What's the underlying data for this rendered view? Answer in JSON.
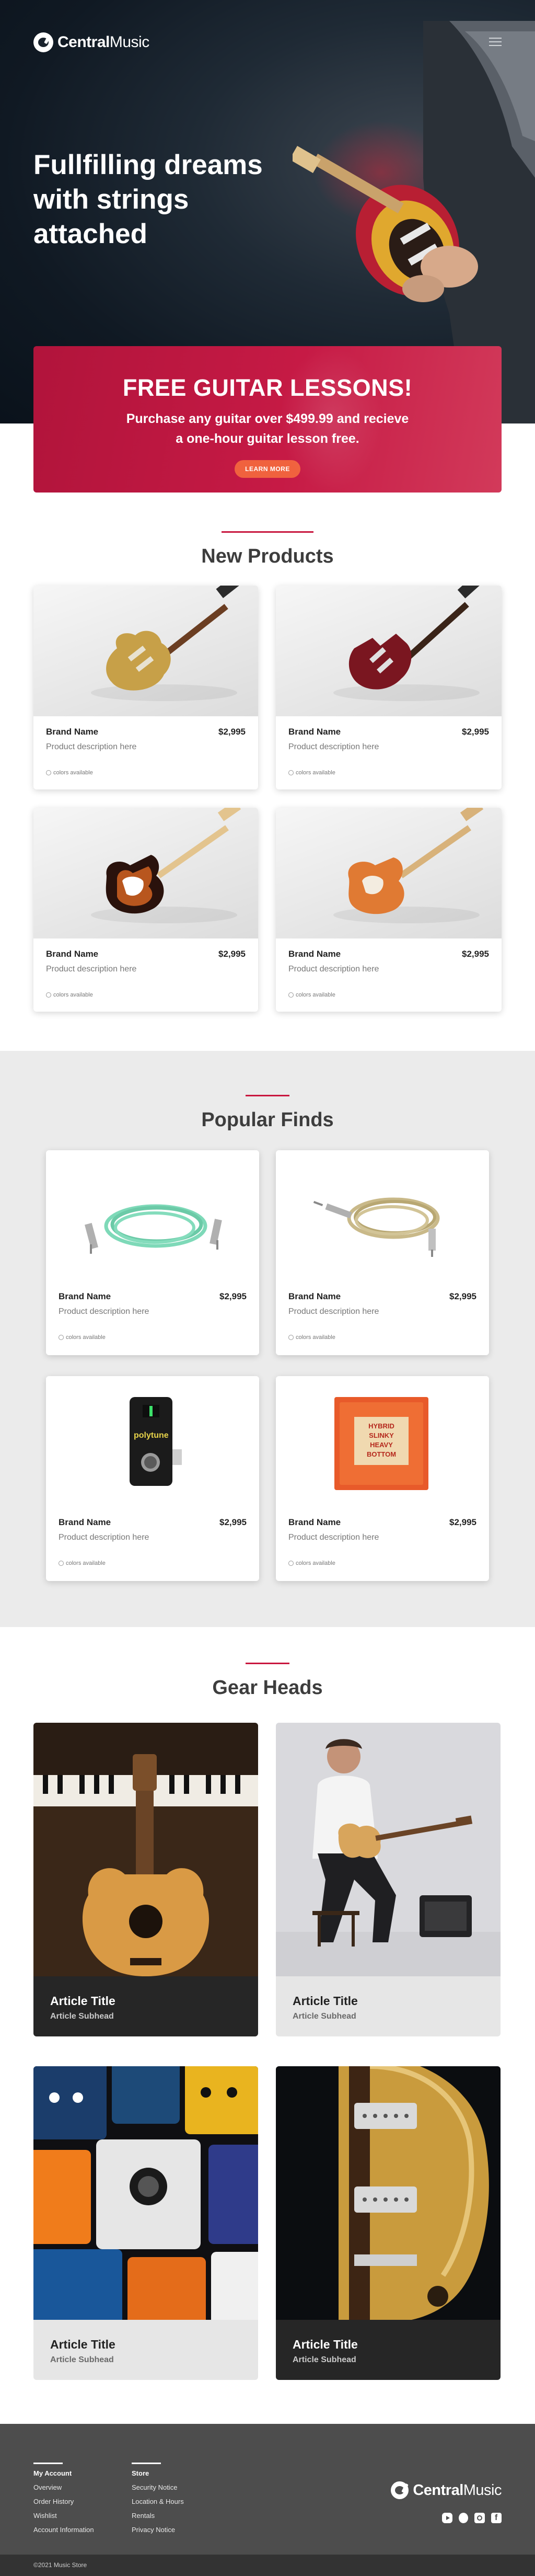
{
  "header": {
    "logo_bold": "Central",
    "logo_regular": "Music",
    "menu_icon": "hamburger-menu-icon"
  },
  "hero": {
    "title": "Fullfilling dreams with strings attached"
  },
  "promo": {
    "title": "FREE GUITAR LESSONS!",
    "text": "Purchase any guitar over $499.99 and recieve a one-hour guitar lesson free.",
    "button": "LEARN MORE",
    "colors": {
      "background": "#c61a45",
      "button": "#f0623e"
    }
  },
  "new_products": {
    "title": "New Products",
    "items": [
      {
        "brand": "Brand Name",
        "price": "$2,995",
        "desc": "Product description here",
        "colors": "colors available"
      },
      {
        "brand": "Brand Name",
        "price": "$2,995",
        "desc": "Product description here",
        "colors": "colors available"
      },
      {
        "brand": "Brand Name",
        "price": "$2,995",
        "desc": "Product description here",
        "colors": "colors available"
      },
      {
        "brand": "Brand Name",
        "price": "$2,995",
        "desc": "Product description here",
        "colors": "colors available"
      }
    ]
  },
  "popular_finds": {
    "title": "Popular Finds",
    "items": [
      {
        "brand": "Brand Name",
        "price": "$2,995",
        "desc": "Product description here",
        "colors": "colors available"
      },
      {
        "brand": "Brand Name",
        "price": "$2,995",
        "desc": "Product description here",
        "colors": "colors available"
      },
      {
        "brand": "Brand Name",
        "price": "$2,995",
        "desc": "Product description here",
        "colors": "colors available",
        "pedal_label": "polytune"
      },
      {
        "brand": "Brand Name",
        "price": "$2,995",
        "desc": "Product description here",
        "colors": "colors available",
        "pack_label": "HYBRID SLINKY HEAVY BOTTOM"
      }
    ]
  },
  "gear_heads": {
    "title": "Gear Heads",
    "articles": [
      {
        "title": "Article Title",
        "subhead": "Article Subhead"
      },
      {
        "title": "Article Title",
        "subhead": "Article Subhead"
      },
      {
        "title": "Article Title",
        "subhead": "Article Subhead"
      },
      {
        "title": "Article Title",
        "subhead": "Article Subhead"
      }
    ]
  },
  "footer": {
    "account": {
      "heading": "My Account",
      "links": [
        "Overview",
        "Order History",
        "Wishlist",
        "Account Information"
      ]
    },
    "store": {
      "heading": "Store",
      "links": [
        "Security Notice",
        "Location & Hours",
        "Rentals",
        "Privacy Notice"
      ]
    },
    "logo_bold": "Central",
    "logo_regular": "Music",
    "social": [
      "youtube-icon",
      "twitter-icon",
      "instagram-icon",
      "facebook-icon"
    ],
    "copyright": "©2021 Music Store"
  },
  "accent_color": "#c8163e"
}
